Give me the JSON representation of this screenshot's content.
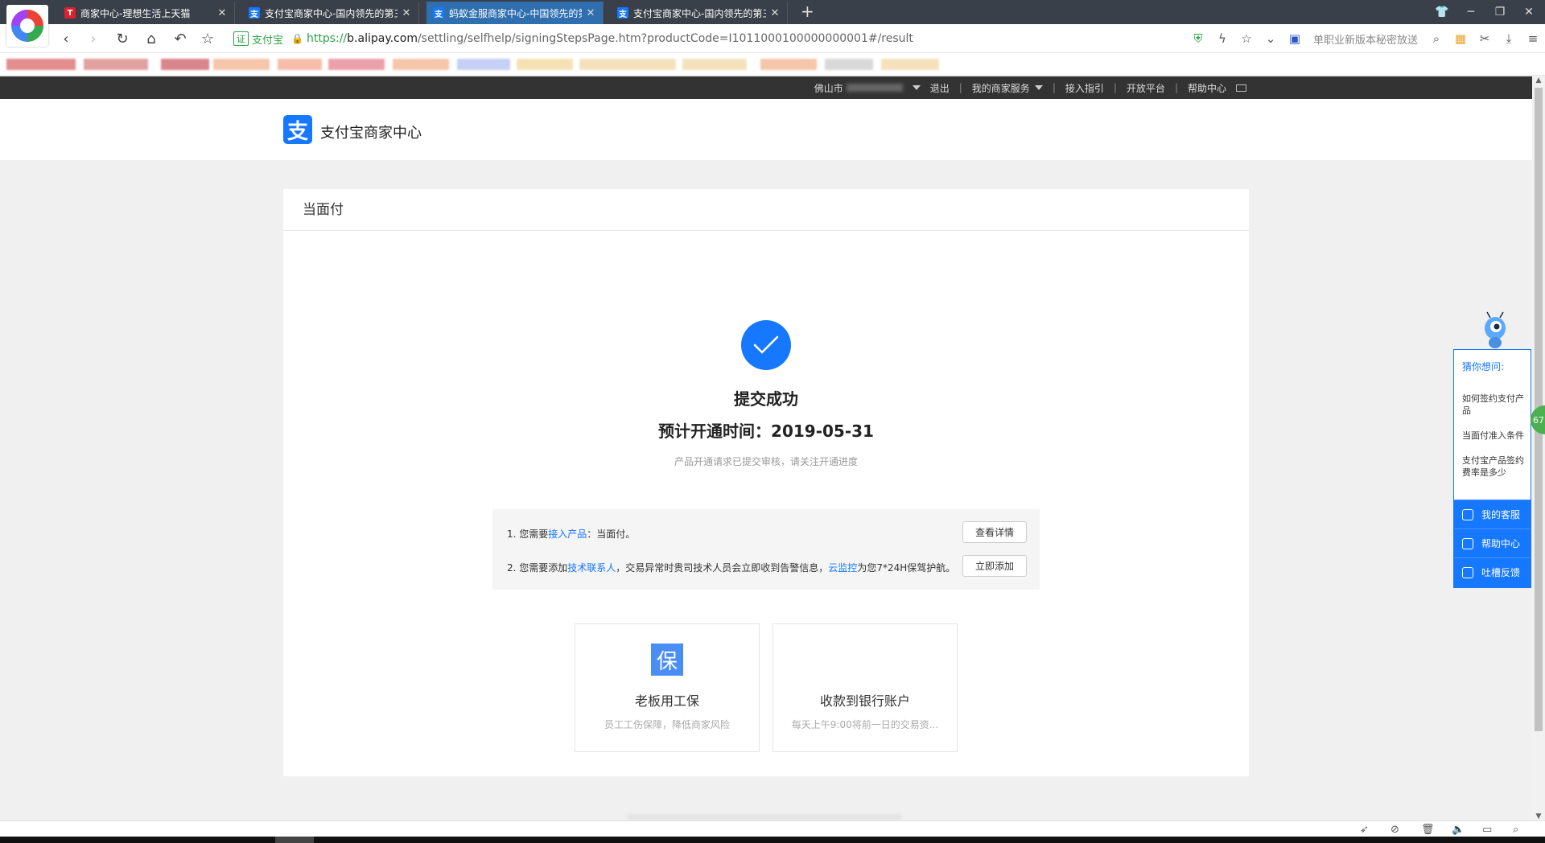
{
  "browser": {
    "tabs": [
      {
        "title": "商家中心-理想生活上天猫",
        "favicon": "tmall-icon",
        "active": false
      },
      {
        "title": "支付宝商家中心-国内领先的第三",
        "favicon": "alipay-icon",
        "active": false
      },
      {
        "title": "蚂蚁金服商家中心-中国领先的第",
        "favicon": "alipay-icon",
        "active": true
      },
      {
        "title": "支付宝商家中心-国内领先的第三",
        "favicon": "alipay-icon",
        "active": false
      }
    ],
    "new_tab": "+",
    "cert_badge": "证",
    "cert_name": "支付宝",
    "url_scheme": "https://",
    "url_host": "b.alipay.com",
    "url_path": "/settling/selfhelp/signingStepsPage.htm?productCode=I1011000100000000001#/result",
    "ad_text": "单职业新版本秘密放送",
    "accent": "#1677ff"
  },
  "topbar": {
    "city": "佛山市",
    "logout": "退出",
    "my_services": "我的商家服务",
    "access_guide": "接入指引",
    "open_platform": "开放平台",
    "help_center": "帮助中心"
  },
  "header": {
    "brand_icon": "支",
    "brand_name": "支付宝商家中心"
  },
  "card": {
    "title": "当面付",
    "success_title": "提交成功",
    "success_date": "预计开通时间：2019-05-31",
    "success_sub": "产品开通请求已提交审核，请关注开通进度",
    "steps": [
      {
        "prefix": "1. 您需要",
        "link": "接入产品",
        "suffix": "：当面付。",
        "button": "查看详情"
      },
      {
        "prefix": "2. 您需要添加",
        "link": "技术联系人",
        "middle": "，交易异常时贵司技术人员会立即收到告警信息，",
        "link2": "云监控",
        "suffix": "为您7*24H保驾护航。",
        "button": "立即添加"
      }
    ],
    "services": [
      {
        "icon": "保",
        "title": "老板用工保",
        "sub": "员工工伤保障，降低商家风险"
      },
      {
        "title": "收款到银行账户",
        "sub": "每天上午9:00将前一日的交易资..."
      }
    ]
  },
  "assistant": {
    "title": "猜你想问:",
    "questions": [
      "如何签约支付产品",
      "当面付准入条件",
      "支付宝产品签约费率是多少"
    ],
    "actions": [
      "我的客服",
      "帮助中心",
      "吐槽反馈"
    ],
    "badge": "67"
  }
}
